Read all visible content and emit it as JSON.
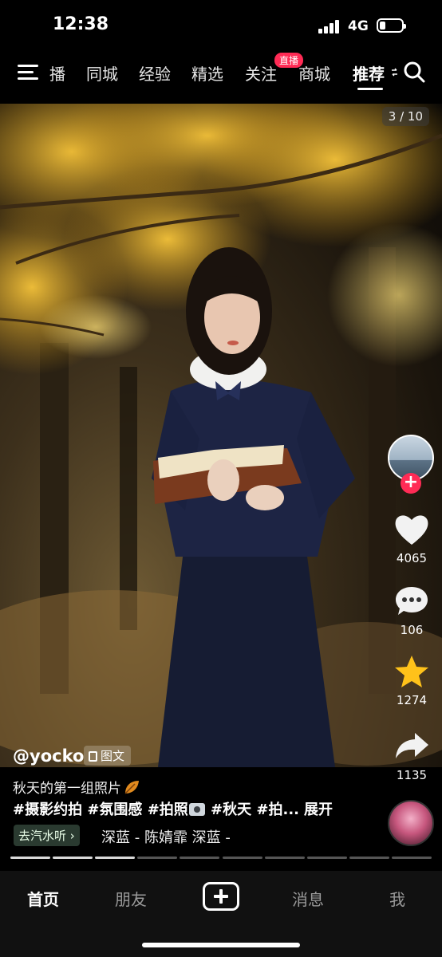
{
  "status_bar": {
    "time": "12:38",
    "network": "4G",
    "battery_level": 0.25
  },
  "top_nav": {
    "tabs": [
      {
        "label": "播"
      },
      {
        "label": "同城"
      },
      {
        "label": "经验"
      },
      {
        "label": "精选"
      },
      {
        "label": "关注",
        "badge": "直播"
      },
      {
        "label": "商城"
      },
      {
        "label": "推荐",
        "active": true
      }
    ]
  },
  "post": {
    "page_counter": "3 / 10",
    "author": "@yocko",
    "type_label": "图文",
    "caption": "秋天的第一组照片",
    "hashtags": "#摄影约拍 #氛围感 #拍照",
    "hashtags_tail": " #秋天 #拍...",
    "expand_label": "展开",
    "music_chip": "去汽水听",
    "music_track": "深蓝 - 陈婧霏    深蓝 -"
  },
  "rail": {
    "likes": "4065",
    "comments": "106",
    "favorites": "1274",
    "shares": "1135",
    "follow_symbol": "+"
  },
  "progress": {
    "total": 10,
    "current": 3
  },
  "bottom_nav": {
    "home": "首页",
    "friends": "朋友",
    "messages": "消息",
    "me": "我"
  },
  "colors": {
    "accent": "#ff2b55",
    "favorite": "#ffc21a",
    "music_chip_bg": "#2a3a30"
  },
  "icons": [
    "menu-icon",
    "search-icon",
    "heart-icon",
    "comment-icon",
    "star-icon",
    "share-icon",
    "plus-icon",
    "leaf-icon",
    "camera-icon",
    "document-icon"
  ]
}
